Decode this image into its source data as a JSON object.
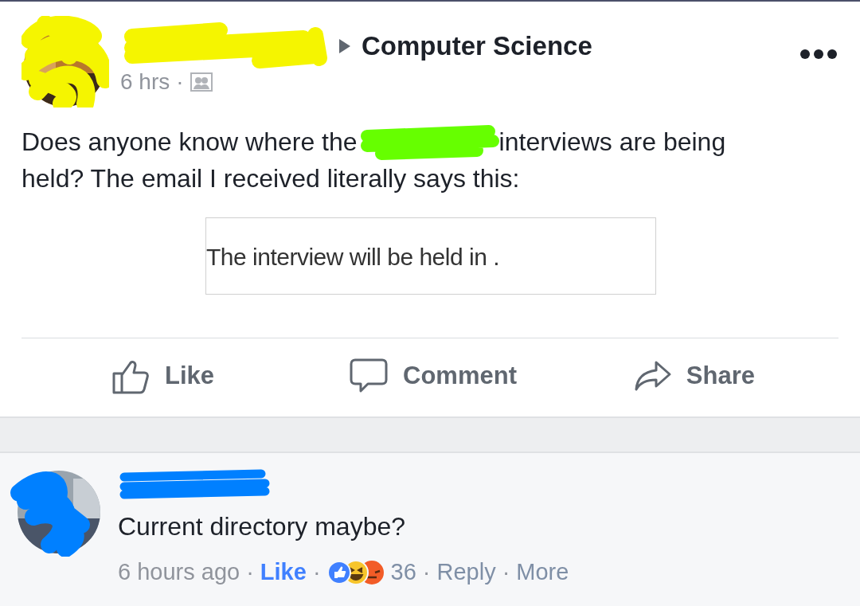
{
  "post": {
    "group": "Computer Science",
    "time": "6 hrs",
    "separator": "·",
    "text_before": "Does anyone know where the",
    "text_after": "interviews are being",
    "text_line2": "held? The email I received literally says this:",
    "quote": "The interview will be held in ."
  },
  "actions": [
    {
      "kind": "like",
      "label": "Like"
    },
    {
      "kind": "comment",
      "label": "Comment"
    },
    {
      "kind": "share",
      "label": "Share"
    }
  ],
  "comment": {
    "text": "Current directory maybe?",
    "time": "6 hours ago",
    "separator": "·",
    "like": "Like",
    "reaction_count": "36",
    "reply": "Reply",
    "more": "More"
  }
}
